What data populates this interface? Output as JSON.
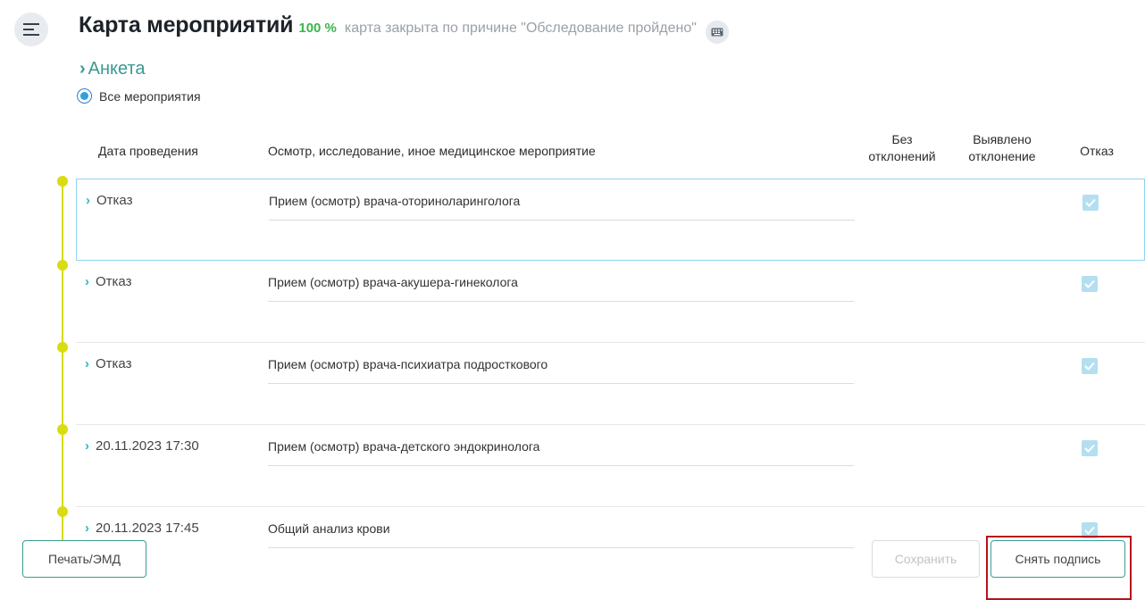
{
  "header": {
    "title": "Карта мероприятий",
    "percent": "100 %",
    "status": "карта закрыта по причине \"Обследование пройдено\"",
    "menu_icon": "hamburger-menu-icon",
    "keyboard_icon": "keyboard-icon"
  },
  "anketa": {
    "label": "Анкета"
  },
  "filter": {
    "label": "Все мероприятия",
    "selected": true
  },
  "table": {
    "columns": {
      "date": "Дата проведения",
      "name": "Осмотр, исследование, иное медицинское мероприятие",
      "no_deviation_1": "Без",
      "no_deviation_2": "отклонений",
      "deviation_1": "Выявлено",
      "deviation_2": "отклонение",
      "refuse": "Отказ"
    },
    "rows": [
      {
        "date": "Отказ",
        "name": "Прием (осмотр) врача-оториноларинголога",
        "refused": true
      },
      {
        "date": "Отказ",
        "name": "Прием (осмотр) врача-акушера-гинеколога",
        "refused": true
      },
      {
        "date": "Отказ",
        "name": "Прием (осмотр) врача-психиатра подросткового",
        "refused": true
      },
      {
        "date": "20.11.2023 17:30",
        "name": "Прием (осмотр) врача-детского эндокринолога",
        "refused": true
      },
      {
        "date": "20.11.2023 17:45",
        "name": "Общий анализ крови",
        "refused": true
      }
    ]
  },
  "footer": {
    "print_label": "Печать/ЭМД",
    "save_label": "Сохранить",
    "unsign_label": "Снять подпись"
  },
  "colors": {
    "accent": "#3a9a8f",
    "percent": "#3ab54a",
    "timeline": "#d6dc15",
    "highlight": "#b5121b"
  }
}
